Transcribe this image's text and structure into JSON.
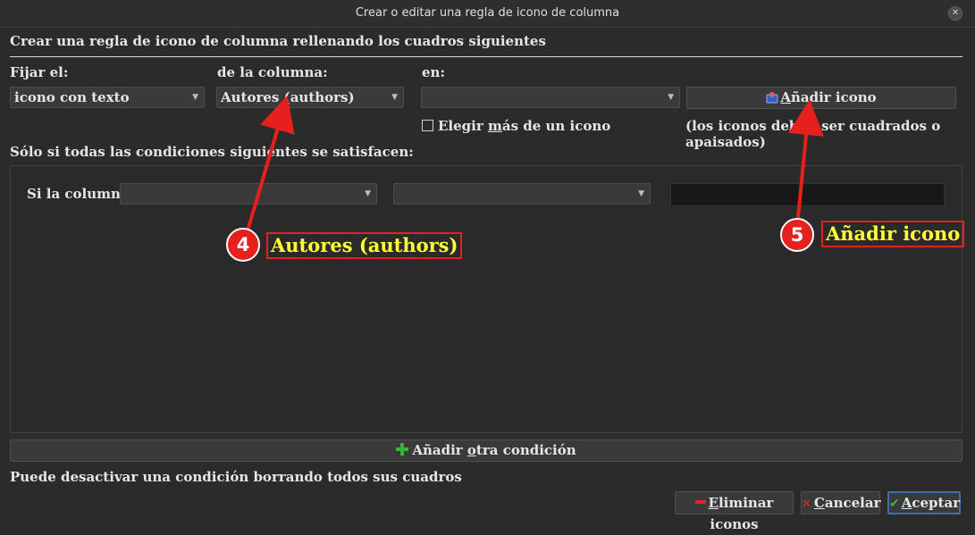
{
  "window": {
    "title": "Crear o editar una regla de icono de columna"
  },
  "heading": "Crear una regla de icono de columna rellenando los cuadros siguientes",
  "fields": {
    "fijar_label": "Fijar el:",
    "fijar_value": "icono con texto",
    "columna_label": "de la columna:",
    "columna_value": "Autores (authors)",
    "en_label": "en:",
    "en_value": ""
  },
  "add_icon_button": {
    "mnemonic": "A",
    "rest": "ñadir icono"
  },
  "multi_icon_checkbox": {
    "before": "Elegir ",
    "mnemonic": "m",
    "after": "ás de un icono",
    "checked": false
  },
  "icon_hint": "(los iconos deben ser cuadrados o apaisados)",
  "conditions": {
    "title": "Sólo si todas las condiciones siguientes se satisfacen:",
    "row_label": "Si la columna",
    "combo1_value": "",
    "combo2_value": "",
    "text_value": ""
  },
  "add_condition_button": {
    "before": "Añadir ",
    "mnemonic": "o",
    "after": "tra condición"
  },
  "footer_hint": "Puede desactivar una condición borrando todos sus cuadros",
  "buttons": {
    "delete": {
      "mnemonic": "E",
      "rest": "liminar iconos"
    },
    "cancel": {
      "mnemonic": "C",
      "rest": "ancelar"
    },
    "accept": {
      "mnemonic": "A",
      "rest": "ceptar"
    }
  },
  "annotations": [
    {
      "number": "4",
      "label": "Autores (authors)"
    },
    {
      "number": "5",
      "label": "Añadir icono"
    }
  ],
  "colors": {
    "background": "#2b2b2b",
    "annotation_red": "#e6201c",
    "annotation_text": "#ffff33",
    "accept_border": "#3d6fb0"
  }
}
